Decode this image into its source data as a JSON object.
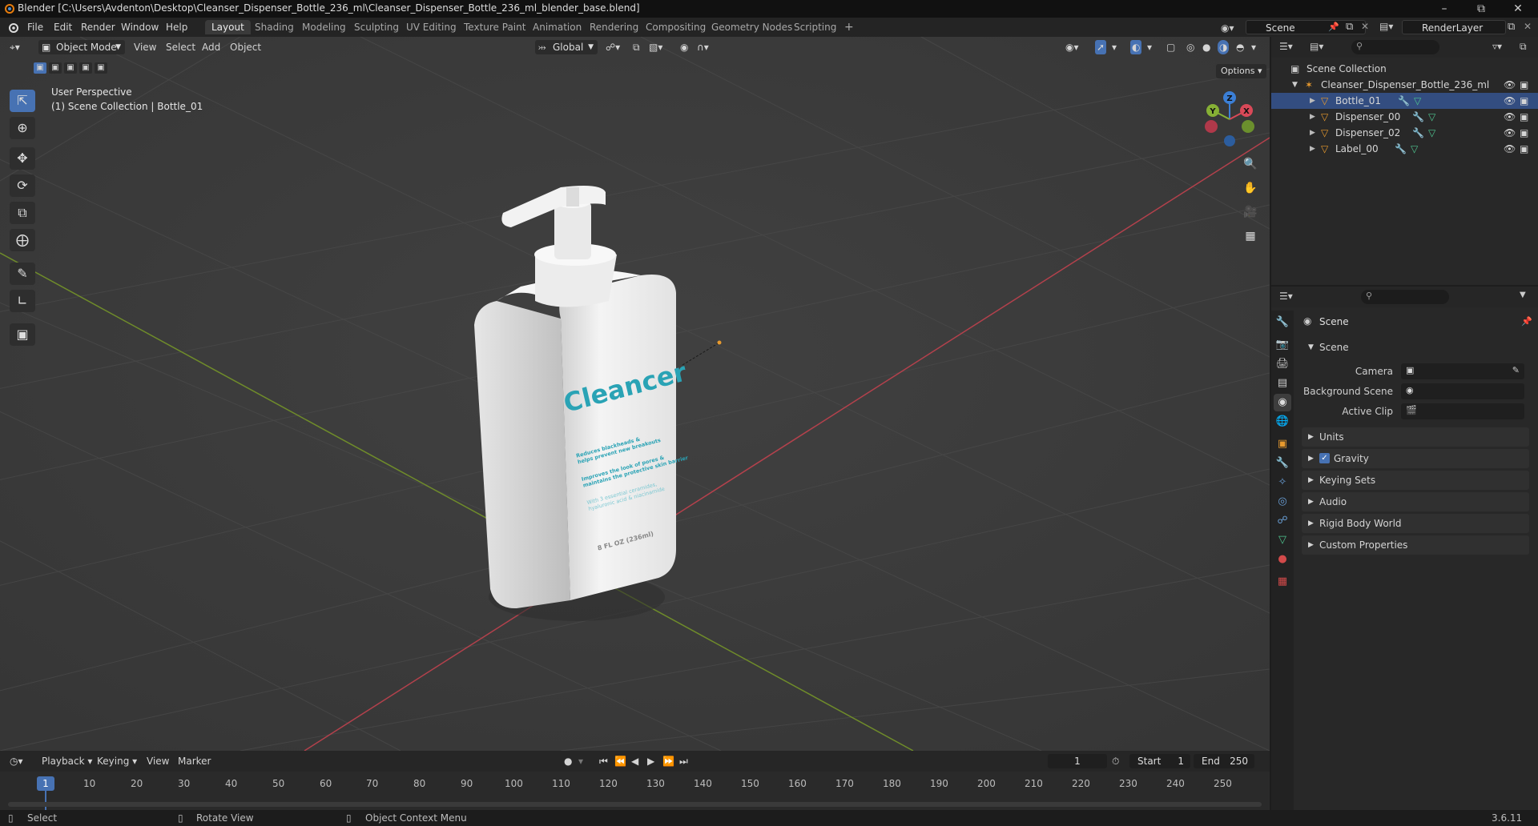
{
  "window": {
    "title": "Blender [C:\\Users\\Avdenton\\Desktop\\Cleanser_Dispenser_Bottle_236_ml\\Cleanser_Dispenser_Bottle_236_ml_blender_base.blend]",
    "minimize": "–",
    "maximize": "⧉",
    "close": "✕"
  },
  "menu": {
    "items": [
      "File",
      "Edit",
      "Render",
      "Window",
      "Help"
    ]
  },
  "workspaces": [
    "Layout",
    "Shading",
    "Modeling",
    "Sculpting",
    "UV Editing",
    "Texture Paint",
    "Animation",
    "Rendering",
    "Compositing",
    "Geometry Nodes",
    "Scripting"
  ],
  "workspace_add": "+",
  "scene_selector": {
    "value": "Scene"
  },
  "view_layer_selector": {
    "value": "RenderLayer"
  },
  "viewport": {
    "mode": "Object Mode",
    "menus": [
      "View",
      "Select",
      "Add",
      "Object"
    ],
    "orientation": "Global",
    "options": "Options",
    "overlay_line1": "User Perspective",
    "overlay_line2": "(1) Scene Collection | Bottle_01",
    "gizmo": {
      "x": "X",
      "y": "Y",
      "z": "Z"
    },
    "bottle_label": {
      "brand": "Cleancer",
      "line1": "Reduces blackheads &",
      "line2": "helps prevent new breakouts",
      "line3": "Improves the look of pores &",
      "line4": "maintains the protective skin barrier",
      "line5": "With 3 essential ceramides,",
      "line6": "hyaluronic acid & niacinamide",
      "volume": "8 FL OZ (236ml)"
    }
  },
  "outliner": {
    "root": "Scene Collection",
    "collection": "Cleanser_Dispenser_Bottle_236_ml",
    "objects": [
      "Bottle_01",
      "Dispenser_00",
      "Dispenser_02",
      "Label_00"
    ]
  },
  "properties": {
    "header": "Scene",
    "panel_scene": "Scene",
    "camera_label": "Camera",
    "background_scene_label": "Background Scene",
    "active_clip_label": "Active Clip",
    "panels": [
      "Units",
      "Gravity",
      "Keying Sets",
      "Audio",
      "Rigid Body World",
      "Custom Properties"
    ]
  },
  "timeline": {
    "menus": [
      "Playback",
      "Keying",
      "View",
      "Marker"
    ],
    "current_frame": "1",
    "start_label": "Start",
    "start_value": "1",
    "end_label": "End",
    "end_value": "250",
    "frame_marks": [
      "1",
      "10",
      "20",
      "30",
      "40",
      "50",
      "60",
      "70",
      "80",
      "90",
      "100",
      "110",
      "120",
      "130",
      "140",
      "150",
      "160",
      "170",
      "180",
      "190",
      "200",
      "210",
      "220",
      "230",
      "240",
      "250"
    ]
  },
  "statusbar": {
    "select": "Select",
    "rotate": "Rotate View",
    "context": "Object Context Menu",
    "version": "3.6.11"
  }
}
